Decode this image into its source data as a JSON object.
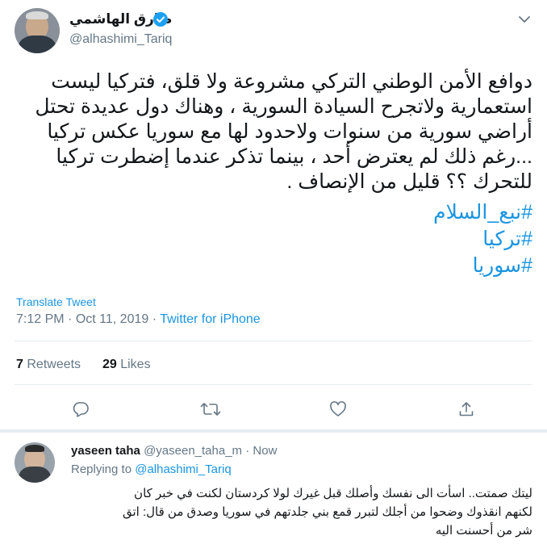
{
  "tweet": {
    "author_name": "طارق الهاشمي",
    "author_handle": "@alhashimi_Tariq",
    "text_lines": [
      "دوافع الأمن الوطني التركي مشروعة ولا قلق، فتركيا ليست",
      "استعمارية ولاتجرح السيادة السورية ، وهناك دول عديدة تحتل",
      "أراضي سورية من سنوات ولاحدود لها مع سوريا عكس تركيا",
      "...رغم ذلك لم يعترض أحد ، بينما تذكر عندما إضطرت تركيا",
      "للتحرك ؟؟ قليل من الإنصاف ."
    ],
    "hashtags": [
      "#نبع_السلام",
      "#تركيا",
      "#سوريا"
    ],
    "translate_label": "Translate Tweet",
    "time": "7:12 PM",
    "separator": "·",
    "date": "Oct 11, 2019",
    "source": "Twitter for iPhone",
    "retweets_count": "7",
    "retweets_label": "Retweets",
    "likes_count": "29",
    "likes_label": "Likes"
  },
  "reply": {
    "author_name": "yaseen taha",
    "author_handle": "@yaseen_taha_m",
    "separator": "·",
    "time": "Now",
    "replying_prefix": "Replying to",
    "replying_to": "@alhashimi_Tariq",
    "text_lines": [
      "ليتك صمتت.. اسأت الى نفسك وأصلك قبل غيرك لولا كردستان  لكنت في خبر كان",
      "لكنهم انقذوك وضحوا من أجلك لتبرر قمع بني جلدتهم في سوريا وصدق من قال: اتق",
      "شر من أحسنت اليه"
    ]
  },
  "colors": {
    "link": "#1b95e0",
    "muted": "#657786",
    "verified": "#1da1f2",
    "divider": "#e6ecf0"
  },
  "icons": [
    "chevron-down-icon",
    "verified-icon",
    "reply-icon",
    "retweet-icon",
    "like-icon",
    "share-icon"
  ]
}
